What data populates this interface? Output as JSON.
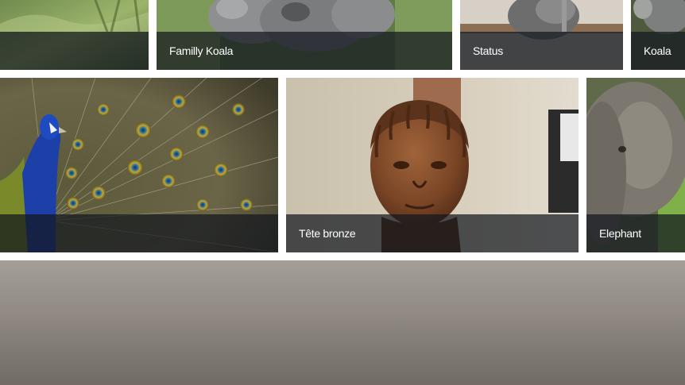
{
  "gallery": {
    "row1": [
      {
        "caption": "",
        "image": "grass-photo"
      },
      {
        "caption": "Familly Koala",
        "image": "koala-family-photo"
      },
      {
        "caption": "Status",
        "image": "stone-statue-photo"
      },
      {
        "caption": "Koala",
        "image": "koala-photo"
      }
    ],
    "row2": [
      {
        "caption": "",
        "image": "peacock-photo"
      },
      {
        "caption": "Tête bronze",
        "image": "bronze-head-photo"
      },
      {
        "caption": "Elephant",
        "image": "elephant-photo"
      }
    ],
    "row3": [
      {
        "caption": "",
        "image": "gray-landscape-photo"
      }
    ]
  },
  "colors": {
    "caption_bg": "#14181e",
    "caption_text": "#ffffff",
    "background": "#ffffff"
  }
}
